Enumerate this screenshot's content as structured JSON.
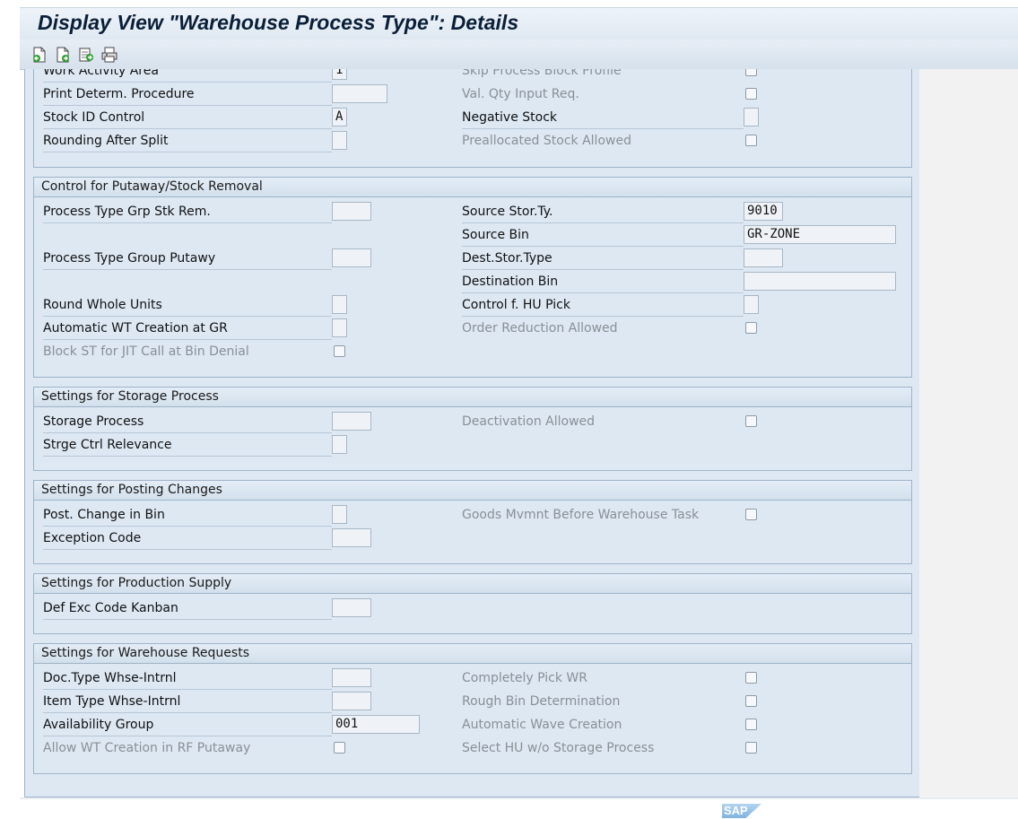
{
  "window": {
    "title": "Display View \"Warehouse Process Type\": Details"
  },
  "toolbar": {
    "buttons": [
      {
        "icon": "first-entry-icon"
      },
      {
        "icon": "next-entry-icon"
      },
      {
        "icon": "last-entry-icon"
      },
      {
        "icon": "print-icon"
      }
    ]
  },
  "top_section": {
    "rows": [
      {
        "left_label": "Work Activity Area",
        "left_value": "1",
        "right_label": "Skip Process Block Profile",
        "right_checked": false
      },
      {
        "left_label": "Print Determ. Procedure",
        "left_value": "",
        "right_label": "Val. Qty Input Req.",
        "right_checked": false
      },
      {
        "left_label": "Stock ID Control",
        "left_value": "A",
        "right_label": "Negative Stock",
        "right_value": ""
      },
      {
        "left_label": "Rounding After Split",
        "left_value": "",
        "right_label": "Preallocated Stock Allowed",
        "right_checked": false
      }
    ]
  },
  "putaway_removal": {
    "title": "Control for Putaway/Stock Removal",
    "process_type_grp_stk_rem": {
      "label": "Process Type Grp Stk Rem.",
      "value": ""
    },
    "process_type_group_putaway": {
      "label": "Process Type Group Putawy",
      "value": ""
    },
    "round_whole_units": {
      "label": "Round Whole Units",
      "value": ""
    },
    "automatic_wt_creation_gr": {
      "label": "Automatic WT Creation at GR",
      "value": ""
    },
    "block_st_jit": {
      "label": "Block ST for JIT Call at Bin Denial",
      "checked": false
    },
    "source_stor_type": {
      "label": "Source Stor.Ty.",
      "value": "9010"
    },
    "source_bin": {
      "label": "Source Bin",
      "value": "GR-ZONE"
    },
    "dest_stor_type": {
      "label": "Dest.Stor.Type",
      "value": ""
    },
    "destination_bin": {
      "label": "Destination Bin",
      "value": ""
    },
    "control_hu_pick": {
      "label": "Control f. HU Pick",
      "value": ""
    },
    "order_reduction_allowed": {
      "label": "Order Reduction Allowed",
      "checked": false
    }
  },
  "storage_process": {
    "title": "Settings for Storage Process",
    "storage_process": {
      "label": "Storage Process",
      "value": ""
    },
    "strge_ctrl_relevance": {
      "label": "Strge Ctrl Relevance",
      "value": ""
    },
    "deactivation_allowed": {
      "label": "Deactivation Allowed",
      "checked": false
    }
  },
  "posting_changes": {
    "title": "Settings for Posting Changes",
    "post_change_in_bin": {
      "label": "Post. Change in Bin",
      "value": ""
    },
    "exception_code": {
      "label": "Exception Code",
      "value": ""
    },
    "goods_mvmnt_before_task": {
      "label": "Goods Mvmnt Before Warehouse Task",
      "checked": false
    }
  },
  "production_supply": {
    "title": "Settings for Production Supply",
    "def_exc_code_kanban": {
      "label": "Def Exc Code Kanban",
      "value": ""
    }
  },
  "warehouse_requests": {
    "title": "Settings for Warehouse Requests",
    "doc_type": {
      "label": "Doc.Type Whse-Intrnl",
      "value": ""
    },
    "item_type": {
      "label": "Item Type Whse-Intrnl",
      "value": ""
    },
    "availability_group": {
      "label": "Availability Group",
      "value": "001"
    },
    "allow_wt_rf_putaway": {
      "label": "Allow WT Creation in RF Putaway",
      "checked": false
    },
    "completely_pick_wr": {
      "label": "Completely Pick WR",
      "checked": false
    },
    "rough_bin_determination": {
      "label": "Rough Bin Determination",
      "checked": false
    },
    "automatic_wave_creation": {
      "label": "Automatic Wave Creation",
      "checked": false
    },
    "select_hu_wo_storage": {
      "label": "Select HU w/o Storage Process",
      "checked": false
    }
  },
  "footer": {
    "logo": "SAP"
  }
}
